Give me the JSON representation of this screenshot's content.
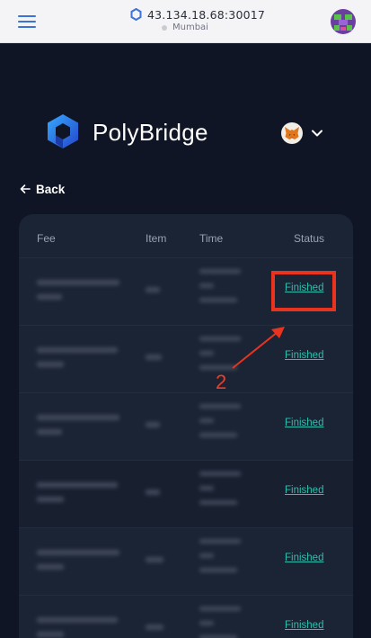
{
  "browser": {
    "address": "43.134.18.68:30017",
    "network": "Mumbai"
  },
  "app": {
    "brand": "PolyBridge",
    "back_label": "Back"
  },
  "table": {
    "headers": {
      "fee": "Fee",
      "item": "Item",
      "time": "Time",
      "status": "Status"
    },
    "rows": [
      {
        "status": "Finished"
      },
      {
        "status": "Finished"
      },
      {
        "status": "Finished"
      },
      {
        "status": "Finished"
      },
      {
        "status": "Finished"
      },
      {
        "status": "Finished"
      }
    ]
  },
  "annotation": {
    "step_number": "2",
    "color": "#e8341f"
  },
  "colors": {
    "background": "#0f1524",
    "table_bg": "#1b2434",
    "accent_link": "#2ebfae",
    "top_bar": "#f4f4f6",
    "menu_icon": "#3b73d6"
  }
}
